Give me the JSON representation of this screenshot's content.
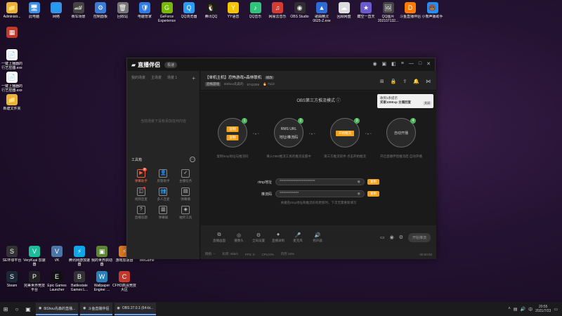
{
  "desktop": {
    "top_row": [
      {
        "label": "Administr...",
        "icon": "user-folder-icon",
        "glyph": "📁",
        "color": "#e8b23c"
      },
      {
        "label": "此电脑",
        "icon": "computer-icon",
        "glyph": "🖥",
        "color": "#3a8ee6"
      },
      {
        "label": "网络",
        "icon": "network-icon",
        "glyph": "🌐",
        "color": "#3a8ee6"
      },
      {
        "label": "赛车场景",
        "icon": "race-icon",
        "glyph": "🏎",
        "color": "#444"
      },
      {
        "label": "控制面板",
        "icon": "control-panel-icon",
        "glyph": "⚙",
        "color": "#3a7bd5"
      },
      {
        "label": "回收站",
        "icon": "recycle-bin-icon",
        "glyph": "🗑",
        "color": "#777"
      },
      {
        "label": "电脑管家",
        "icon": "pc-manager-icon",
        "glyph": "🛡",
        "color": "#2f7be3"
      },
      {
        "label": "GeForce Experience",
        "icon": "geforce-icon",
        "glyph": "G",
        "color": "#76b900"
      },
      {
        "label": "QQ浏览器",
        "icon": "qq-browser-icon",
        "glyph": "Q",
        "color": "#2b9bf4"
      },
      {
        "label": "腾讯QQ",
        "icon": "qq-icon",
        "glyph": "🐧",
        "color": "#1a1a1a"
      },
      {
        "label": "YY语音",
        "icon": "yy-icon",
        "glyph": "Y",
        "color": "#f5c400"
      },
      {
        "label": "QQ音乐",
        "icon": "qq-music-icon",
        "glyph": "♪",
        "color": "#31c27c"
      },
      {
        "label": "网易云音乐",
        "icon": "netease-music-icon",
        "glyph": "♫",
        "color": "#d43c33"
      },
      {
        "label": "OBS Studio",
        "icon": "obs-icon",
        "glyph": "◉",
        "color": "#302e31"
      },
      {
        "label": "歌曲精灵 0625-Z.exe",
        "icon": "exe-icon",
        "glyph": "▲",
        "color": "#2d6bd6"
      },
      {
        "label": "回顾网盘",
        "icon": "cloud-drive-icon",
        "glyph": "☁",
        "color": "#ddd"
      },
      {
        "label": "藏空一直天",
        "icon": "app-icon",
        "glyph": "★",
        "color": "#6a5acd"
      },
      {
        "label": "QQ图片 2021071​32...",
        "icon": "image-icon",
        "glyph": "🖼",
        "color": "#444"
      },
      {
        "label": "斗鱼直播伴侣",
        "icon": "douyu-icon",
        "glyph": "D",
        "color": "#ff7a00"
      },
      {
        "label": "小熊声播助手",
        "icon": "bear-icon",
        "glyph": "🐻",
        "color": "#1e90ff"
      }
    ],
    "left_col": [
      {
        "label": "",
        "icon": "app-box-icon",
        "glyph": "▦",
        "color": "#c0392b"
      },
      {
        "label": "一键上播器的行艺控器.exe",
        "icon": "file-icon",
        "glyph": "📄",
        "color": "#fff"
      },
      {
        "label": "一键上播器的行艺控器.exe",
        "icon": "file-icon",
        "glyph": "📄",
        "color": "#fff"
      },
      {
        "label": "新建文件夹",
        "icon": "folder-icon",
        "glyph": "📁",
        "color": "#e8b23c"
      }
    ],
    "bottom_rows": [
      [
        {
          "label": "SE环球平台",
          "icon": "game-icon",
          "glyph": "S",
          "color": "#333"
        },
        {
          "label": "VeryKuai 加速器",
          "icon": "accelerator-icon",
          "glyph": "V",
          "color": "#1abc9c"
        },
        {
          "label": "VK",
          "icon": "vk-icon",
          "glyph": "V",
          "color": "#4a76a8"
        },
        {
          "label": "腾讯网游加速器",
          "icon": "tencent-accel-icon",
          "glyph": "⚡",
          "color": "#0ea5e9"
        },
        {
          "label": "我的世界启动器",
          "icon": "minecraft-icon",
          "glyph": "▣",
          "color": "#5b8731"
        },
        {
          "label": "游戏加速器",
          "icon": "game-accel-icon",
          "glyph": "⚡",
          "color": "#e67e22"
        },
        {
          "label": "WeGame",
          "icon": "wegame-icon",
          "glyph": "W",
          "color": "#f6b93b"
        }
      ],
      [
        {
          "label": "Steam",
          "icon": "steam-icon",
          "glyph": "S",
          "color": "#1b2838"
        },
        {
          "label": "完美世界竞技平台",
          "icon": "perfect-world-icon",
          "glyph": "P",
          "color": "#222"
        },
        {
          "label": "Epic Games Launcher",
          "icon": "epic-icon",
          "glyph": "E",
          "color": "#111"
        },
        {
          "label": "Battlestate Games L...",
          "icon": "battlestate-icon",
          "glyph": "B",
          "color": "#333"
        },
        {
          "label": "Wallpaper Engine: ...",
          "icon": "wallpaper-icon",
          "glyph": "W",
          "color": "#2980b9"
        },
        {
          "label": "CFHD高清竞技大区",
          "icon": "cfhd-icon",
          "glyph": "C",
          "color": "#c0392b"
        }
      ]
    ]
  },
  "app": {
    "logo": "直播伴侣",
    "version": "极速",
    "left": {
      "tabs": [
        "我的场景",
        "主场景",
        "场景 1"
      ],
      "empty_text": "当前场景下没有添加任何内容",
      "tools_header": "工具箱",
      "tools": [
        {
          "label": "弹幕助手",
          "glyph": "▶",
          "active": true,
          "badge": "新"
        },
        {
          "label": "房管助手",
          "glyph": "👤",
          "active": false
        },
        {
          "label": "主播任务",
          "glyph": "✓",
          "active": false
        },
        {
          "label": "视频连麦",
          "glyph": "◫",
          "active": false,
          "dot": true
        },
        {
          "label": "多人连麦",
          "glyph": "👥",
          "active": false
        },
        {
          "label": "弹幕播",
          "glyph": "▤",
          "active": false
        },
        {
          "label": "直播答题",
          "glyph": "?",
          "active": false
        },
        {
          "label": "弹幕娱",
          "glyph": "▥",
          "active": false
        },
        {
          "label": "抽奖工具",
          "glyph": "◈",
          "active": false
        }
      ]
    },
    "channel": {
      "title": "【单机主机】恐怖游戏+森林联机",
      "edit": "修改",
      "category": "恐怖游戏",
      "room": "8iShou先森的",
      "fans": "5742259",
      "heat": "🔥 7113"
    },
    "stage": {
      "mode_title": "OBS第三方推流模式",
      "promo_line1": "收到1条提示",
      "promo_line2": "买家100Exp 主播回复",
      "promo_close": "关闭",
      "steps": [
        {
          "num": "1",
          "btn1": "复制",
          "btn2": "复制",
          "caption": "复制rtmp地址与推流码"
        },
        {
          "num": "2",
          "line1": "RMS URL",
          "line2": "地址/推流码",
          "caption": "填入OBS推流工具的推流设置中"
        },
        {
          "num": "3",
          "btn": "开始推流",
          "caption": "第三方推流软件 点击开始推流"
        },
        {
          "num": "4",
          "line1": "自动开播",
          "caption": "开启直播伴侣推流后 自动开播"
        }
      ],
      "rtmp_label": "rtmp地址",
      "rtmp_value": "**************************",
      "key_label": "推流码",
      "key_value": "**************",
      "copy_label": "复制",
      "hint": "关播后rtmp地址和推流码有更新时，下次无需重新填写"
    },
    "toolbar": [
      {
        "label": "直播画面",
        "glyph": "⧉"
      },
      {
        "label": "摄像头",
        "glyph": "◎"
      },
      {
        "label": "全局设置",
        "glyph": "⚙"
      },
      {
        "label": "直播录制",
        "glyph": "⏺"
      },
      {
        "label": "麦克风",
        "glyph": "🎤"
      },
      {
        "label": "扬声器",
        "glyph": "🔊"
      }
    ],
    "start_label": "开始推流",
    "status": {
      "net": "网络: --",
      "bitrate": "码率: 0kb/s",
      "fps": "FPS: 0",
      "cpu": "CPU:0%",
      "mem": "内存:18%",
      "time": "00:00:00"
    }
  },
  "taskbar": {
    "tasks": [
      {
        "label": "8iShou先森的直播...",
        "icon": "qq-browser-icon"
      },
      {
        "label": "斗鱼直播伴侣",
        "icon": "douyu-icon"
      },
      {
        "label": "OBS 27.0.1 (64-bi...",
        "icon": "obs-icon"
      }
    ],
    "time": "20:55",
    "date": "2021/7/23"
  }
}
